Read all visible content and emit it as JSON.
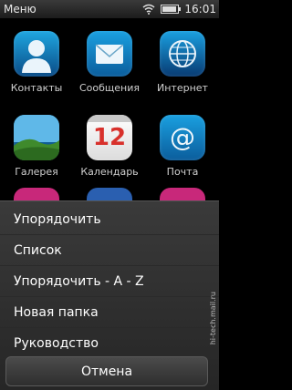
{
  "status": {
    "title": "Меню",
    "time": "16:01"
  },
  "apps": [
    {
      "label": "Контакты",
      "icon": "contacts-icon"
    },
    {
      "label": "Сообщения",
      "icon": "messages-icon"
    },
    {
      "label": "Интернет",
      "icon": "web-icon"
    },
    {
      "label": "Галерея",
      "icon": "gallery-icon"
    },
    {
      "label": "Календарь",
      "icon": "calendar-icon",
      "badge": "12"
    },
    {
      "label": "Почта",
      "icon": "mail-icon"
    }
  ],
  "menu": {
    "items": [
      "Упорядочить",
      "Список",
      "Упорядочить - A - Z",
      "Новая папка",
      "Руководство"
    ],
    "cancel": "Отмена"
  },
  "watermark": "hi-tech.mail.ru"
}
